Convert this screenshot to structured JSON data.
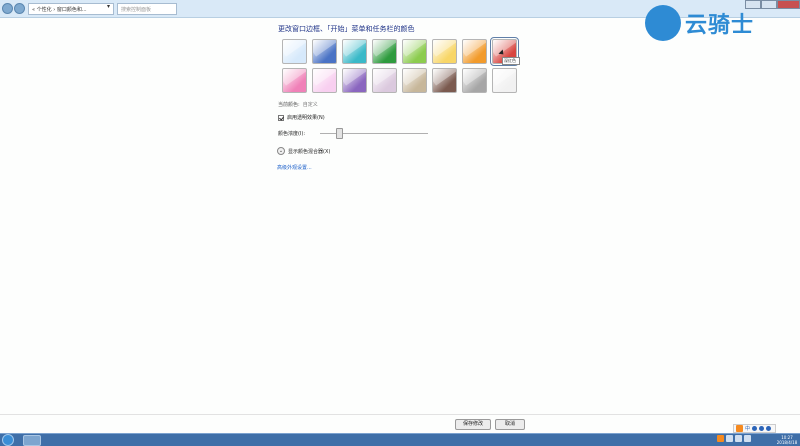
{
  "address_bar": {
    "path": "« 个性化 › 窗口颜色和...",
    "search_placeholder": "搜索控制面板"
  },
  "watermark": {
    "text": "云骑士"
  },
  "main": {
    "heading": "更改窗口边框、「开始」菜单和任务栏的颜色",
    "swatch_colors_row1": [
      "#d6e9fb",
      "#4a73c5",
      "#3ab9c8",
      "#2e9b3e",
      "#8ccc4e",
      "#f8d667",
      "#f29b2b",
      "#d8453f"
    ],
    "swatch_colors_row2": [
      "#f081b8",
      "#f8cff0",
      "#8a66bf",
      "#dbc9de",
      "#c7b79a",
      "#7b5a4f",
      "#a6a6a6",
      "#f1f1f1"
    ],
    "selected_swatch_tooltip": "深红色",
    "current_label": "当前颜色:",
    "current_value": "自定义",
    "transparency_label": "启用透明效果(N)",
    "transparency_checked": true,
    "intensity_label": "颜色浓度(I):",
    "intensity_level": 0.15,
    "mixer_label": "显示颜色混合器(X)",
    "advanced_link": "高级外观设置..."
  },
  "footer": {
    "save_label": "保存修改",
    "cancel_label": "取消"
  },
  "taskbar": {
    "ime_label": "中",
    "time": "10:27",
    "date": "2018/4/18"
  }
}
